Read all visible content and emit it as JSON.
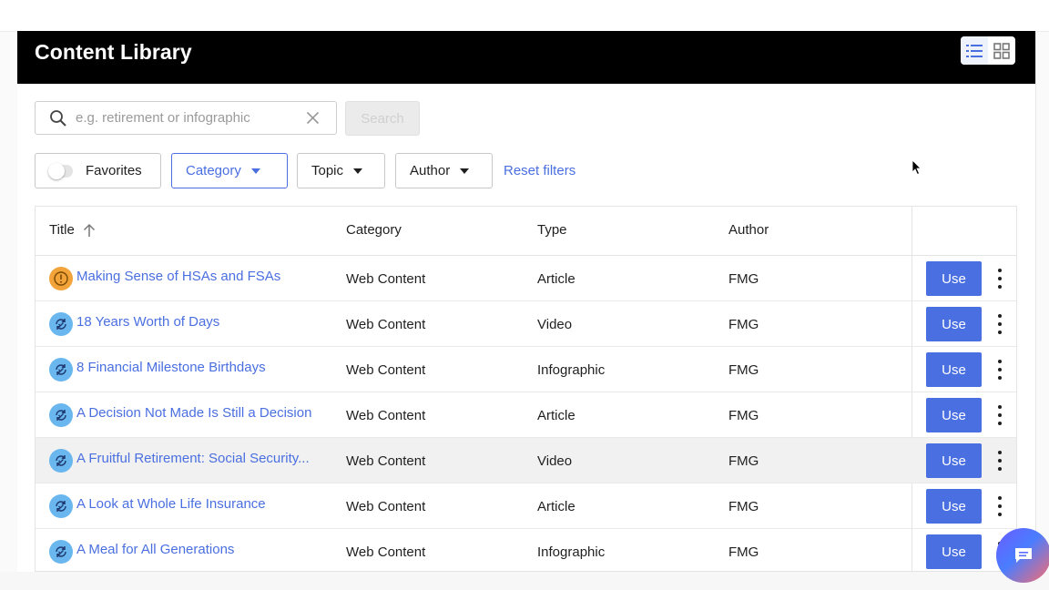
{
  "header": {
    "title": "Content Library",
    "view_list_icon": "list-view-icon",
    "view_grid_icon": "grid-view-icon"
  },
  "search": {
    "value": "",
    "placeholder": "e.g. retirement or infographic",
    "button_label": "Search"
  },
  "filters": {
    "favorites_label": "Favorites",
    "favorites_on": false,
    "category_label": "Category",
    "topic_label": "Topic",
    "author_label": "Author",
    "reset_label": "Reset filters"
  },
  "table": {
    "headers": {
      "title": "Title",
      "category": "Category",
      "type": "Type",
      "author": "Author"
    },
    "sort": "ascending",
    "rows": [
      {
        "title": "Making Sense of HSAs and FSAs",
        "category": "Web Content",
        "type": "Article",
        "author": "FMG",
        "icon": "alert-clock-icon",
        "use_label": "Use"
      },
      {
        "title": "18 Years Worth of Days",
        "category": "Web Content",
        "type": "Video",
        "author": "FMG",
        "icon": "refresh-check-icon",
        "use_label": "Use"
      },
      {
        "title": "8 Financial Milestone Birthdays",
        "category": "Web Content",
        "type": "Infographic",
        "author": "FMG",
        "icon": "refresh-check-icon",
        "use_label": "Use"
      },
      {
        "title": "A Decision Not Made Is Still a Decision",
        "category": "Web Content",
        "type": "Article",
        "author": "FMG",
        "icon": "refresh-check-icon",
        "use_label": "Use"
      },
      {
        "title": "A Fruitful Retirement: Social Security...",
        "category": "Web Content",
        "type": "Video",
        "author": "FMG",
        "icon": "refresh-check-icon",
        "use_label": "Use"
      },
      {
        "title": "A Look at Whole Life Insurance",
        "category": "Web Content",
        "type": "Article",
        "author": "FMG",
        "icon": "refresh-check-icon",
        "use_label": "Use"
      },
      {
        "title": "A Meal for All Generations",
        "category": "Web Content",
        "type": "Infographic",
        "author": "FMG",
        "icon": "refresh-check-icon",
        "use_label": "Use"
      }
    ]
  },
  "colors": {
    "accent": "#4a6fe0",
    "header_bg": "#000000",
    "alert_icon": "#f2a33a",
    "sync_icon": "#6ab7f0",
    "row_highlight": "#f1f1f1"
  },
  "chat_icon": "chat-bubble-icon"
}
